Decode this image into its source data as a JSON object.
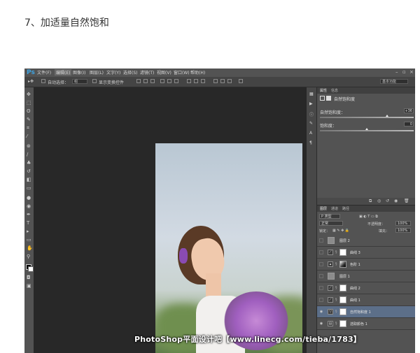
{
  "step_title": "7、加适量自然饱和",
  "app": {
    "logo": "Ps",
    "menus": [
      "文件(F)",
      "编辑(E)",
      "图像(I)",
      "图层(L)",
      "文字(Y)",
      "选择(S)",
      "滤镜(T)",
      "视图(V)",
      "窗口(W)",
      "帮助(H)"
    ],
    "active_menu_index": 1,
    "workspace": "基本功能"
  },
  "options_bar": {
    "auto_select_label": "自动选择：",
    "auto_select_value": "组",
    "show_transform_label": "显示变换控件"
  },
  "adjustments_panel": {
    "tabs": [
      "属性",
      "信息"
    ],
    "title": "自然饱和度",
    "vibrance_label": "自然饱和度：",
    "vibrance_value": "+36",
    "saturation_label": "饱和度：",
    "saturation_value": "0"
  },
  "layers_panel": {
    "tabs": [
      "图层",
      "通道",
      "路径"
    ],
    "filter_type": "P 类型",
    "blend_mode": "正常",
    "opacity_label": "不透明度：",
    "opacity_value": "100%",
    "lock_label": "锁定：",
    "fill_label": "填充：",
    "fill_value": "100%",
    "layers": [
      {
        "name": "图层 2",
        "visible": false,
        "selected": false,
        "kind": "pixel"
      },
      {
        "name": "曲线 3",
        "visible": false,
        "selected": false,
        "kind": "curves"
      },
      {
        "name": "色阶 1",
        "visible": false,
        "selected": false,
        "kind": "levels"
      },
      {
        "name": "图层 1",
        "visible": false,
        "selected": false,
        "kind": "pixel"
      },
      {
        "name": "曲线 2",
        "visible": false,
        "selected": false,
        "kind": "curves"
      },
      {
        "name": "曲线 1",
        "visible": false,
        "selected": false,
        "kind": "curves"
      },
      {
        "name": "自然饱和度 1",
        "visible": true,
        "selected": true,
        "kind": "vibrance"
      },
      {
        "name": "选取颜色 1",
        "visible": true,
        "selected": false,
        "kind": "selective"
      }
    ]
  },
  "watermark": "PhotoShop平面设计吧【www.linecg.com/tieba/1783】"
}
